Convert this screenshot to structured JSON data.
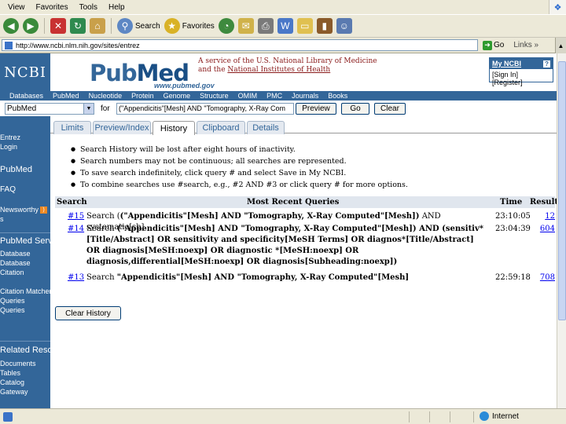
{
  "browser": {
    "menu": [
      "View",
      "Favorites",
      "Tools",
      "Help"
    ],
    "toolbar": {
      "search_label": "Search",
      "favorites_label": "Favorites"
    },
    "address": {
      "url": "http://www.ncbi.nlm.nih.gov/sites/entrez",
      "go_label": "Go",
      "links_label": "Links"
    }
  },
  "header": {
    "ncbi_logo": "NCBI",
    "pubmed_logo_a": "Pub",
    "pubmed_logo_b": "Med",
    "pubmed_sub": "www.pubmed.gov",
    "service_line1": "A service of the U.S. National Library of Medicine",
    "service_line2_pre": "and the ",
    "service_line2_link": "National Institutes of Health",
    "myncbi": "My NCBI",
    "myncbi_help": "?",
    "sign_in": "[Sign In] [Register]"
  },
  "nav": [
    "Databases",
    "PubMed",
    "Nucleotide",
    "Protein",
    "Genome",
    "Structure",
    "OMIM",
    "PMC",
    "Journals",
    "Books"
  ],
  "search": {
    "database": "PubMed",
    "for_label": "for",
    "query": "(\"Appendicitis\"[Mesh] AND \"Tomography, X-Ray Com",
    "preview": "Preview",
    "go": "Go",
    "clear": "Clear"
  },
  "tabs": [
    "Limits",
    "Preview/Index",
    "History",
    "Clipboard",
    "Details"
  ],
  "active_tab": "History",
  "notes": [
    "Search History will be lost after eight hours of inactivity.",
    "Search numbers may not be continuous; all searches are represented.",
    "To save search indefinitely, click query # and select Save in My NCBI.",
    "To combine searches use #search, e.g., #2 AND #3 or click query # for more options."
  ],
  "results": {
    "headers": {
      "search": "Search",
      "query": "Most Recent Queries",
      "time": "Time",
      "result": "Result"
    },
    "rows": [
      {
        "num": "#15",
        "q_pre": "Search (",
        "q_bold": "(\"Appendicitis\"[Mesh] AND \"Tomography, X-Ray Computed\"[Mesh])",
        "q_post": " AND systematic[sb]",
        "time": "23:10:05",
        "count": "12"
      },
      {
        "num": "#14",
        "q_pre": "Search ",
        "q_bold": "(\"Appendicitis\"[Mesh] AND \"Tomography, X-Ray Computed\"[Mesh]) AND (sensitiv*[Title/Abstract] OR sensitivity and specificity[MeSH Terms] OR diagnos*[Title/Abstract] OR diagnosis[MeSH:noexp] OR diagnostic *[MeSH:noexp] OR diagnosis,differential[MeSH:noexp] OR diagnosis[Subheading:noexp])",
        "q_post": "",
        "time": "23:04:39",
        "count": "604"
      },
      {
        "num": "#13",
        "q_pre": "Search ",
        "q_bold": "\"Appendicitis\"[Mesh] AND \"Tomography, X-Ray Computed\"[Mesh]",
        "q_post": "",
        "time": "22:59:18",
        "count": "708"
      }
    ]
  },
  "clear_history": "Clear History",
  "sidebar": {
    "items_top": [
      "Entrez",
      "Login"
    ],
    "pubmed": "PubMed",
    "faq": "FAQ",
    "newsworthy": "Newsworthy",
    "newsworthy2": "s",
    "services_head": "PubMed Services",
    "services": [
      "Database",
      "Database",
      "Citation",
      "Citation Matcher",
      "Queries",
      "Queries"
    ],
    "resources_head": "Related Resources",
    "resources": [
      "Documents",
      "Tables",
      "Catalog",
      "Gateway"
    ],
    "rss": "RSS"
  },
  "status": {
    "zone": "Internet"
  }
}
